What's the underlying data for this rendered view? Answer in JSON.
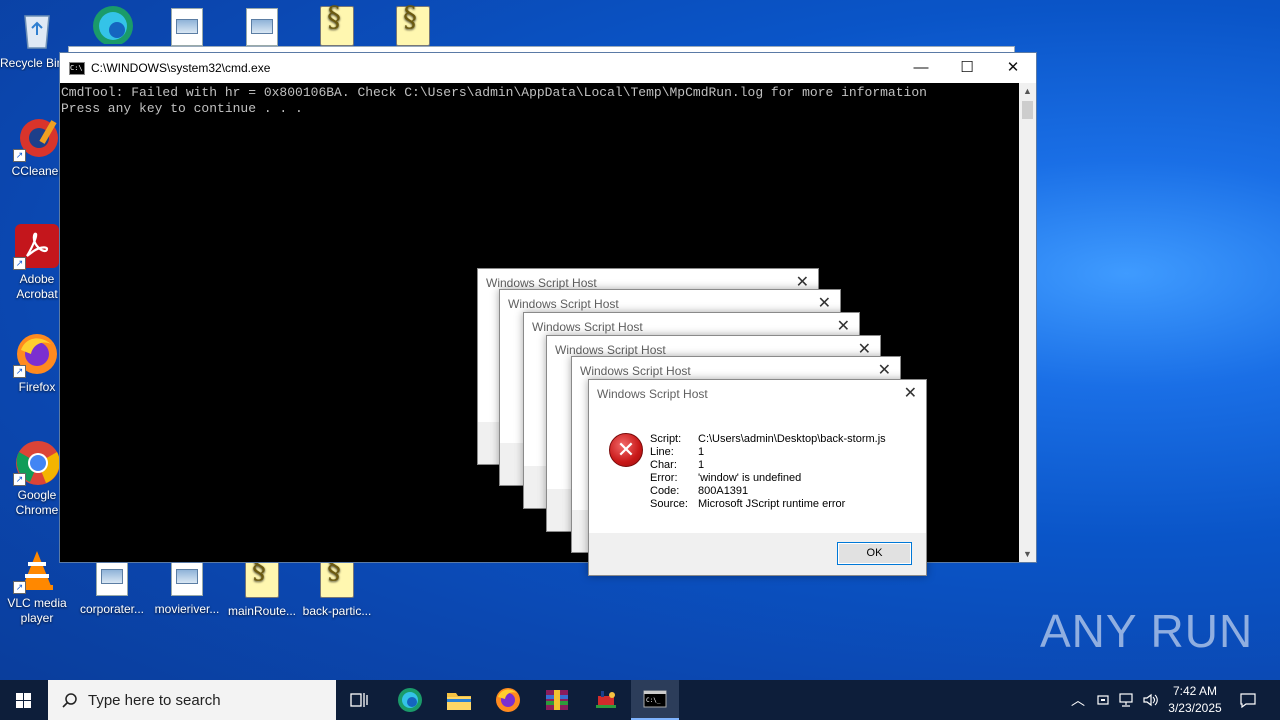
{
  "desktop": {
    "top_icons": [
      {
        "label": "Recycle Bin",
        "kind": "recycle"
      },
      {
        "label": "",
        "kind": "edge"
      },
      {
        "label": "",
        "kind": "file"
      },
      {
        "label": "",
        "kind": "file"
      },
      {
        "label": "",
        "kind": "script"
      },
      {
        "label": "",
        "kind": "script"
      }
    ],
    "left_icons": [
      {
        "label": "CCleaner"
      },
      {
        "label": "Adobe Acrobat"
      },
      {
        "label": "Firefox"
      },
      {
        "label": "Google Chrome"
      },
      {
        "label": "VLC media player"
      }
    ],
    "bottom_icons": [
      {
        "label": "corporater..."
      },
      {
        "label": "movieriver..."
      },
      {
        "label": "mainRoute..."
      },
      {
        "label": "back-partic..."
      }
    ],
    "watermark": "ANY RUN"
  },
  "cmd_window": {
    "title": "C:\\WINDOWS\\system32\\cmd.exe",
    "lines": [
      "CmdTool: Failed with hr = 0x800106BA. Check C:\\Users\\admin\\AppData\\Local\\Temp\\MpCmdRun.log for more information",
      "",
      "Press any key to continue . . ."
    ],
    "minimize": "—",
    "maximize": "☐",
    "close": "✕"
  },
  "dialogs": {
    "title": "Windows Script Host",
    "close": "✕",
    "front": {
      "fields": [
        {
          "key": "Script:",
          "value": "C:\\Users\\admin\\Desktop\\back-storm.js"
        },
        {
          "key": "Line:",
          "value": "1"
        },
        {
          "key": "Char:",
          "value": "1"
        },
        {
          "key": "Error:",
          "value": "'window' is undefined"
        },
        {
          "key": "Code:",
          "value": "800A1391"
        },
        {
          "key": "Source:",
          "value": "Microsoft JScript runtime error"
        }
      ],
      "ok_label": "OK"
    }
  },
  "taskbar": {
    "search_placeholder": "Type here to search",
    "time": "7:42 AM",
    "date": "3/23/2025",
    "accent": "#0d1e3a"
  }
}
